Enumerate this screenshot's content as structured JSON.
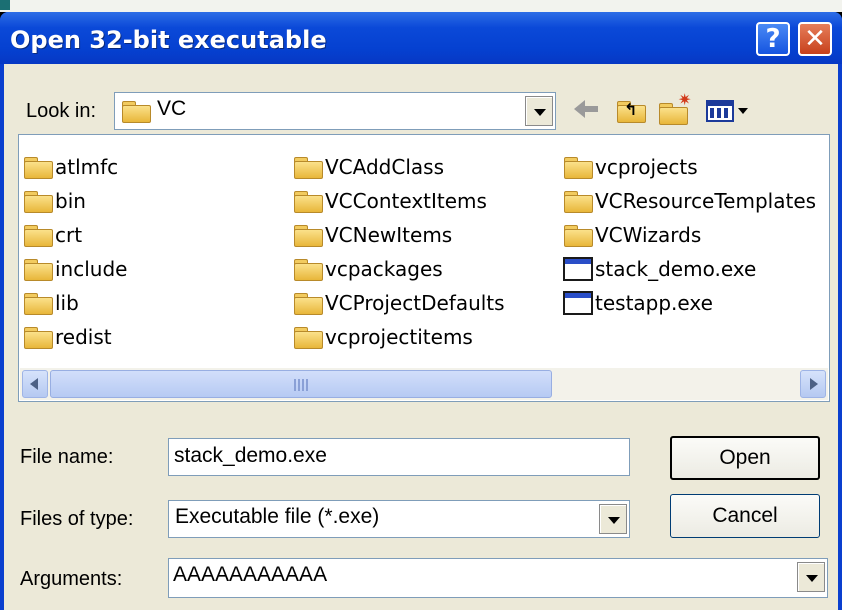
{
  "window": {
    "title": "Open 32-bit executable",
    "help_label": "?",
    "close_label": "✕"
  },
  "lookin": {
    "label": "Look in:",
    "value": "VC"
  },
  "toolbar": {
    "icons": [
      "back-arrow-icon",
      "up-one-level-icon",
      "create-new-folder-icon",
      "view-menu-icon"
    ]
  },
  "files": {
    "col1": [
      {
        "name": "atlmfc",
        "type": "folder"
      },
      {
        "name": "bin",
        "type": "folder"
      },
      {
        "name": "crt",
        "type": "folder"
      },
      {
        "name": "include",
        "type": "folder"
      },
      {
        "name": "lib",
        "type": "folder"
      },
      {
        "name": "redist",
        "type": "folder"
      }
    ],
    "col2": [
      {
        "name": "VCAddClass",
        "type": "folder"
      },
      {
        "name": "VCContextItems",
        "type": "folder"
      },
      {
        "name": "VCNewItems",
        "type": "folder"
      },
      {
        "name": "vcpackages",
        "type": "folder"
      },
      {
        "name": "VCProjectDefaults",
        "type": "folder"
      },
      {
        "name": "vcprojectitems",
        "type": "folder"
      }
    ],
    "col3": [
      {
        "name": "vcprojects",
        "type": "folder"
      },
      {
        "name": "VCResourceTemplates",
        "type": "folder"
      },
      {
        "name": "VCWizards",
        "type": "folder"
      },
      {
        "name": "stack_demo.exe",
        "type": "exe"
      },
      {
        "name": "testapp.exe",
        "type": "exe"
      }
    ]
  },
  "form": {
    "filename_label": "File name:",
    "filename_value": "stack_demo.exe",
    "filetype_label": "Files of type:",
    "filetype_value": "Executable file (*.exe)",
    "arguments_label": "Arguments:",
    "arguments_value": "AAAAAAAAAAA"
  },
  "buttons": {
    "open": "Open",
    "cancel": "Cancel"
  },
  "colors": {
    "titlebar": "#0a46d2",
    "dialog_bg": "#ece9d8",
    "folder": "#f2cb5f"
  }
}
